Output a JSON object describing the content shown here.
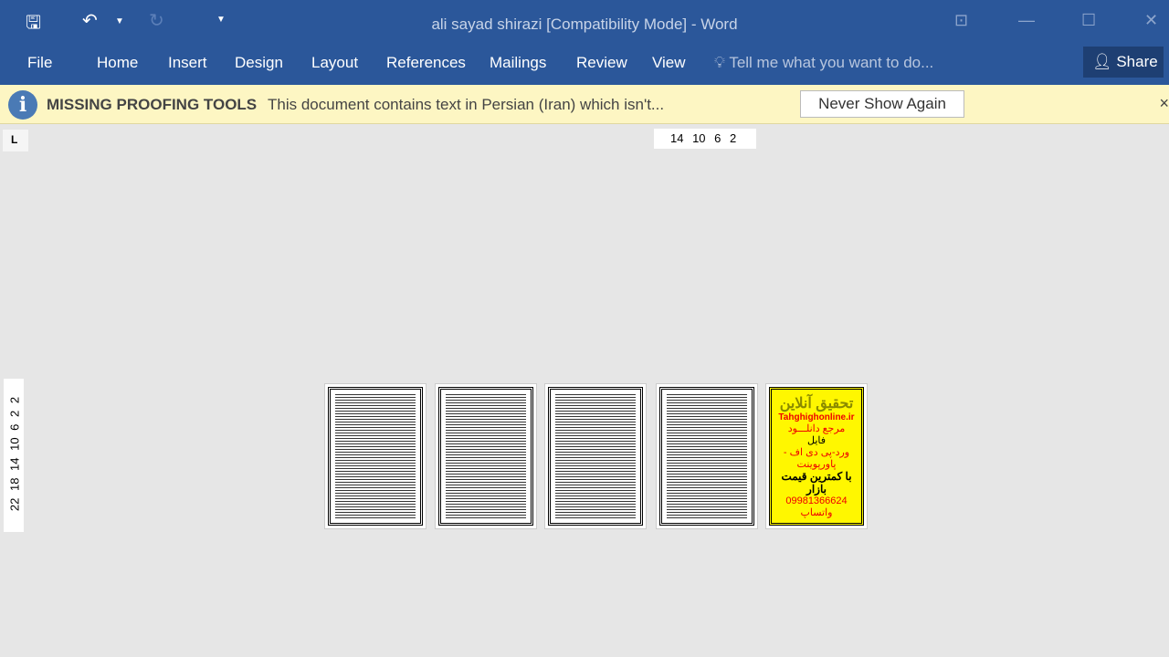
{
  "window": {
    "title": "ali sayad shirazi [Compatibility Mode] - Word"
  },
  "quick_access": {
    "save": "save-icon",
    "undo": "undo-icon",
    "redo": "redo-icon",
    "customize": "customize-icon"
  },
  "tabs": [
    {
      "label": "File"
    },
    {
      "label": "Home"
    },
    {
      "label": "Insert"
    },
    {
      "label": "Design"
    },
    {
      "label": "Layout"
    },
    {
      "label": "References"
    },
    {
      "label": "Mailings"
    },
    {
      "label": "Review"
    },
    {
      "label": "View"
    }
  ],
  "tell_me": "Tell me what you want to do...",
  "share": "Share",
  "message_bar": {
    "title": "MISSING PROOFING TOOLS",
    "text": "This document contains text in Persian (Iran) which isn't...",
    "button": "Never Show Again",
    "close": "×"
  },
  "ruler": {
    "horizontal": "14 10 6 2",
    "vertical": "22 18 14 10 6 2 2"
  },
  "ad_page": {
    "title": "تحقیق آنلاین",
    "site": "Tahghighonline.ir",
    "line1": "مرجع دانلـــود",
    "line2": "فایل",
    "line3": "ورد-پی دی اف - پاورپوینت",
    "line4": "با کمترین قیمت بازار",
    "line5": "09981366624 واتساپ"
  },
  "colors": {
    "ribbon": "#2b579a",
    "message_bar": "#fdf6c3"
  }
}
